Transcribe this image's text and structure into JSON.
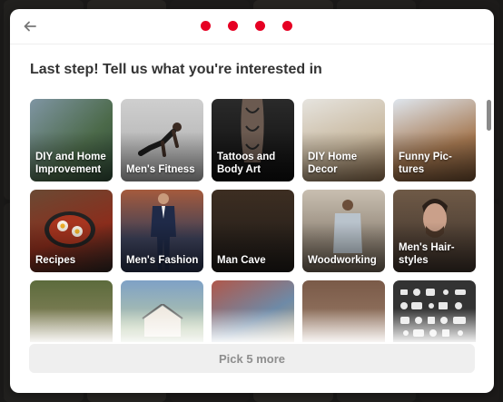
{
  "header": {
    "back_icon": "arrow-left-icon",
    "progress_steps": 4,
    "progress_color": "#e60023"
  },
  "title": "Last step! Tell us what you're interested in",
  "topics": [
    {
      "label": "DIY and Home\nImprovement"
    },
    {
      "label": "Men's Fitness"
    },
    {
      "label": "Tattoos and\nBody Art"
    },
    {
      "label": "DIY Home\nDecor"
    },
    {
      "label": "Funny Pic-\ntures"
    },
    {
      "label": "Recipes"
    },
    {
      "label": "Men's Fashion"
    },
    {
      "label": "Man Cave"
    },
    {
      "label": "Woodworking"
    },
    {
      "label": "Men's Hair-\nstyles"
    },
    {
      "label": ""
    },
    {
      "label": ""
    },
    {
      "label": ""
    },
    {
      "label": ""
    },
    {
      "label": ""
    }
  ],
  "pick_button": "Pick 5 more"
}
